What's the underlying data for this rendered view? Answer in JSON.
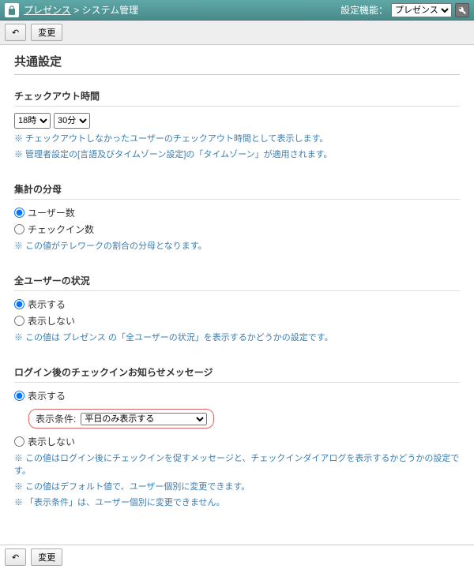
{
  "topbar": {
    "app": "プレゼンス",
    "page": "システム管理",
    "settingLabel": "設定機能：",
    "settingValue": "プレゼンス"
  },
  "toolbar": {
    "back": "↶",
    "change": "変更"
  },
  "heading": "共通設定",
  "checkout": {
    "title": "チェックアウト時間",
    "hour": "18時",
    "minute": "30分",
    "note1": "※ チェックアウトしなかったユーザーのチェックアウト時間として表示します。",
    "note2": "※ 管理者設定の[言語及びタイムゾーン設定]の「タイムゾーン」が適用されます。"
  },
  "denom": {
    "title": "集計の分母",
    "opt1": "ユーザー数",
    "opt2": "チェックイン数",
    "note": "※ この値がテレワークの割合の分母となります。"
  },
  "allusers": {
    "title": "全ユーザーの状況",
    "show": "表示する",
    "hide": "表示しない",
    "note": "※ この値は プレゼンス の「全ユーザーの状況」を表示するかどうかの設定です。"
  },
  "login": {
    "title": "ログイン後のチェックインお知らせメッセージ",
    "show": "表示する",
    "hide": "表示しない",
    "condLabel": "表示条件:",
    "condValue": "平日のみ表示する",
    "note1": "※ この値はログイン後にチェックインを促すメッセージと、チェックインダイアログを表示するかどうかの設定です。",
    "note2": "※ この値はデフォルト値で、ユーザー個別に変更できます。",
    "note3": "※ 「表示条件」は、ユーザー個別に変更できません。"
  }
}
